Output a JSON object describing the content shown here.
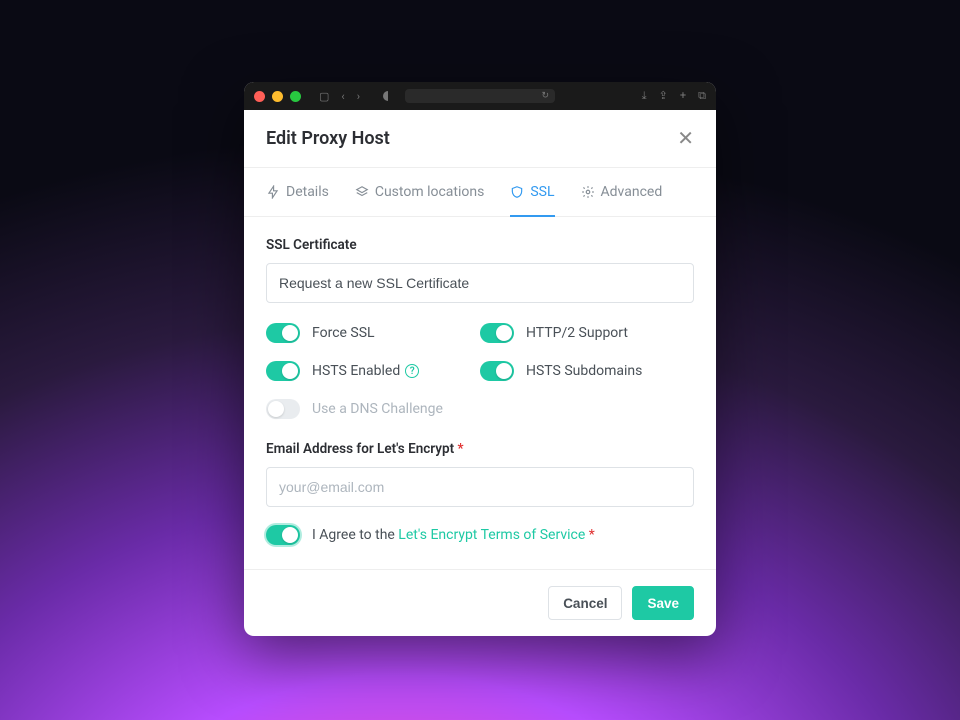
{
  "modal": {
    "title": "Edit Proxy Host"
  },
  "tabs": {
    "details": "Details",
    "custom_locations": "Custom locations",
    "ssl": "SSL",
    "advanced": "Advanced"
  },
  "ssl": {
    "cert_label": "SSL Certificate",
    "cert_value": "Request a new SSL Certificate",
    "force_ssl": "Force SSL",
    "http2": "HTTP/2 Support",
    "hsts": "HSTS Enabled",
    "hsts_sub": "HSTS Subdomains",
    "dns_challenge": "Use a DNS Challenge",
    "email_label": "Email Address for Let's Encrypt",
    "email_placeholder": "your@email.com",
    "agree_prefix": "I Agree to the ",
    "agree_link": "Let's Encrypt Terms of Service"
  },
  "footer": {
    "cancel": "Cancel",
    "save": "Save"
  },
  "required_marker": " *"
}
